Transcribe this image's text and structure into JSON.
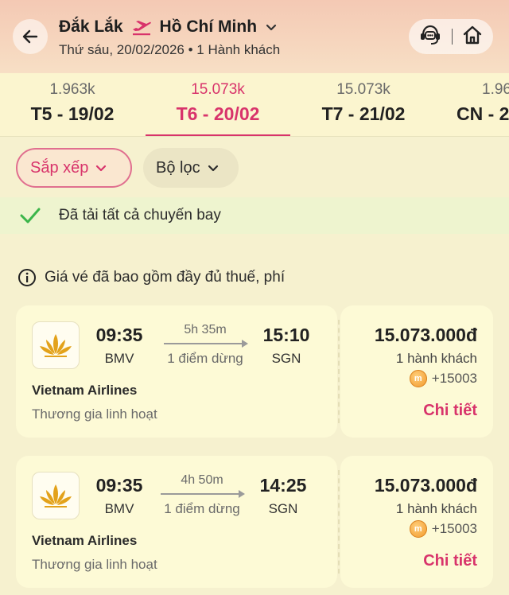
{
  "header": {
    "origin": "Đắk Lắk",
    "destination": "Hồ Chí Minh",
    "subtitle": "Thứ sáu, 20/02/2026 • 1 Hành khách"
  },
  "dates": [
    {
      "price": "1.963k",
      "day": "T5 - 19/02",
      "active": false
    },
    {
      "price": "15.073k",
      "day": "T6 - 20/02",
      "active": true
    },
    {
      "price": "15.073k",
      "day": "T7 - 21/02",
      "active": false
    },
    {
      "price": "1.96",
      "day": "CN - 2",
      "active": false
    }
  ],
  "filters": {
    "sort_label": "Sắp xếp",
    "filter_label": "Bộ lọc"
  },
  "status": {
    "loaded_text": "Đã tải tất cả chuyến bay"
  },
  "note": {
    "text": "Giá vé đã bao gồm đầy đủ thuế, phí"
  },
  "flights": [
    {
      "dep_time": "09:35",
      "dep_code": "BMV",
      "duration": "5h 35m",
      "stops": "1 điểm dừng",
      "arr_time": "15:10",
      "arr_code": "SGN",
      "airline": "Vietnam Airlines",
      "fare_class": "Thương gia linh hoạt",
      "price": "15.073.000đ",
      "pax": "1 hành khách",
      "points": "+15003",
      "detail_label": "Chi tiết"
    },
    {
      "dep_time": "09:35",
      "dep_code": "BMV",
      "duration": "4h 50m",
      "stops": "1 điểm dừng",
      "arr_time": "14:25",
      "arr_code": "SGN",
      "airline": "Vietnam Airlines",
      "fare_class": "Thương gia linh hoạt",
      "price": "15.073.000đ",
      "pax": "1 hành khách",
      "points": "+15003",
      "detail_label": "Chi tiết"
    }
  ],
  "colors": {
    "accent": "#d8336b",
    "check": "#3bb54a",
    "logo_gold": "#e3a21a"
  }
}
